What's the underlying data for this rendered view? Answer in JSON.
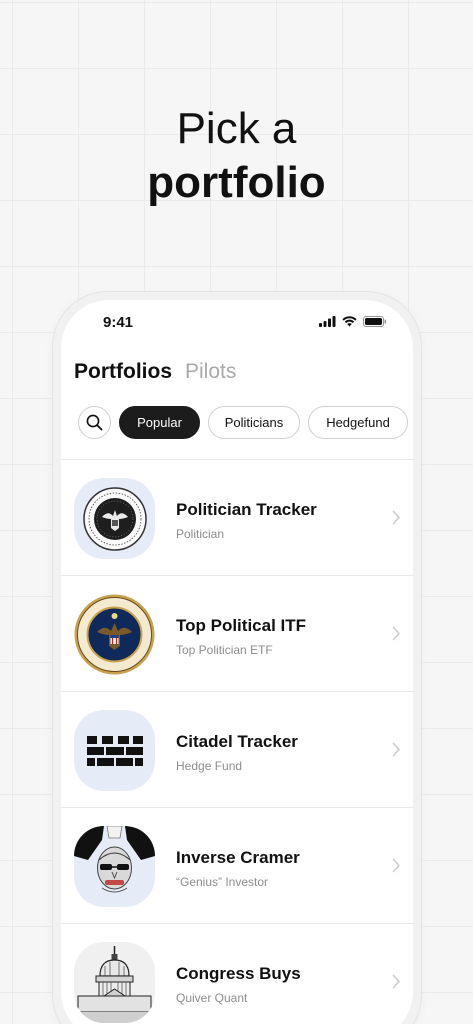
{
  "headline": {
    "line1": "Pick a",
    "line2": "portfolio"
  },
  "status_bar": {
    "time": "9:41"
  },
  "tabs": [
    {
      "label": "Portfolios",
      "active": true
    },
    {
      "label": "Pilots",
      "active": false
    }
  ],
  "filters": {
    "search_icon": "search-icon",
    "chips": [
      {
        "label": "Popular",
        "active": true
      },
      {
        "label": "Politicians",
        "active": false
      },
      {
        "label": "Hedgefund",
        "active": false
      }
    ]
  },
  "portfolios": [
    {
      "title": "Politician Tracker",
      "subtitle": "Politician",
      "icon": "presidential-seal-icon"
    },
    {
      "title": "Top Political ITF",
      "subtitle": "Top Politician ETF",
      "icon": "presidential-seal-color-icon"
    },
    {
      "title": "Citadel Tracker",
      "subtitle": "Hedge Fund",
      "icon": "citadel-wall-icon"
    },
    {
      "title": "Inverse Cramer",
      "subtitle": "“Genius” Investor",
      "icon": "cramer-caricature-icon"
    },
    {
      "title": "Congress Buys",
      "subtitle": "Quiver Quant",
      "icon": "capitol-building-icon"
    }
  ],
  "colors": {
    "background": "#f6f6f6",
    "active_chip": "#1c1c1c",
    "thumb_bg": "#e6ebf8",
    "muted_text": "#8d8d8d",
    "inactive_tab": "#a9a9a9"
  }
}
